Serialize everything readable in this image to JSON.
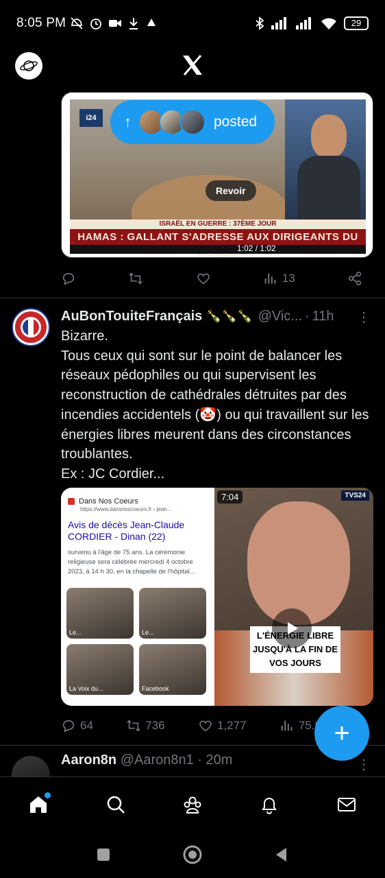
{
  "status_bar": {
    "time": "8:05 PM",
    "battery": "29"
  },
  "top_bar": {
    "logo": "X"
  },
  "new_posts_pill": {
    "label": "posted"
  },
  "tweet1": {
    "media": {
      "channel": "i24",
      "button": "Revoir",
      "ticker_top": "ISRAËL EN GUERRE : 37ÈME JOUR",
      "ticker_main": "HAMAS : GALLANT S'ADRESSE AUX DIRIGEANTS DU MONDE",
      "timecode": "1:02 / 1:02"
    },
    "actions": {
      "views": "13"
    }
  },
  "tweet2": {
    "name": "AuBonTouiteFrançais",
    "emoji": "🍾🍾🍾",
    "handle": "@Vic...",
    "time": "11h",
    "text": "Bizarre.\nTous ceux qui sont sur le point de balancer les réseaux pédophiles ou qui supervisent les reconstruction de cathédrales détruites par des incendies accidentels (🤡) ou qui travaillent sur les énergies libres meurent dans des circonstances troublantes.\nEx : JC Cordier...",
    "media": {
      "site": "Dans Nos Coeurs",
      "url": "https://www.dansnoscoeurs.fr › jean...",
      "title": "Avis de décès Jean-Claude CORDIER - Dinan (22)",
      "snippet": "survenu à l'âge de 75 ans. La cérémonie religieuse sera célébrée mercredi 4 octobre 2023, à 14 h 30, en la chapelle de l'hôpital...",
      "thumbs": [
        "Le...",
        "Le...",
        "La Voix du...",
        "Facebook"
      ],
      "video_time": "7:04",
      "video_channel": "TVS24",
      "video_caption": "L'ÉNERGIE LIBRE JUSQU'À LA FIN DE VOS JOURS"
    },
    "actions": {
      "replies": "64",
      "reposts": "736",
      "likes": "1,277",
      "views": "75.9"
    }
  },
  "tweet3": {
    "name": "Aaron8n",
    "handle": "@Aaron8n1",
    "time": "20m"
  },
  "fab": {
    "label": "+"
  },
  "bottom_nav": [
    "home-icon",
    "search-icon",
    "communities-icon",
    "notifications-icon",
    "messages-icon"
  ],
  "colors": {
    "accent": "#1d9bf0",
    "muted": "#71767b",
    "text": "#e7e9ea",
    "background": "#000000"
  }
}
